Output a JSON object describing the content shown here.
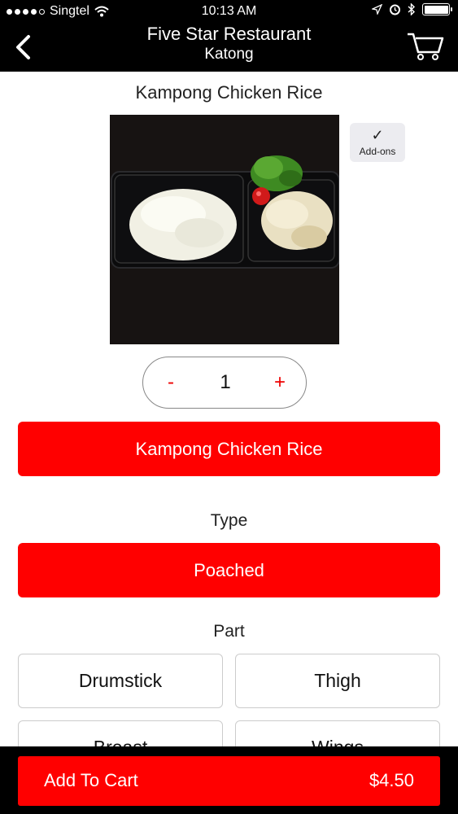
{
  "status_bar": {
    "carrier": "Singtel",
    "time": "10:13 AM"
  },
  "nav": {
    "title": "Five Star Restaurant",
    "subtitle": "Katong",
    "icons": [
      "chevron-left-icon",
      "shopping-cart-icon"
    ]
  },
  "item": {
    "name": "Kampong Chicken Rice",
    "addons_label": "Add-ons",
    "quantity": "1",
    "minus_label": "-",
    "plus_label": "+",
    "selected_item_label": "Kampong Chicken Rice"
  },
  "type_section": {
    "label": "Type",
    "selected": "Poached"
  },
  "part_section": {
    "label": "Part",
    "options": [
      "Drumstick",
      "Thigh",
      "Breast",
      "Wings"
    ]
  },
  "cart": {
    "label": "Add To Cart",
    "price": "$4.50"
  },
  "colors": {
    "accent": "#ff0000",
    "bar_bg": "#000000"
  }
}
